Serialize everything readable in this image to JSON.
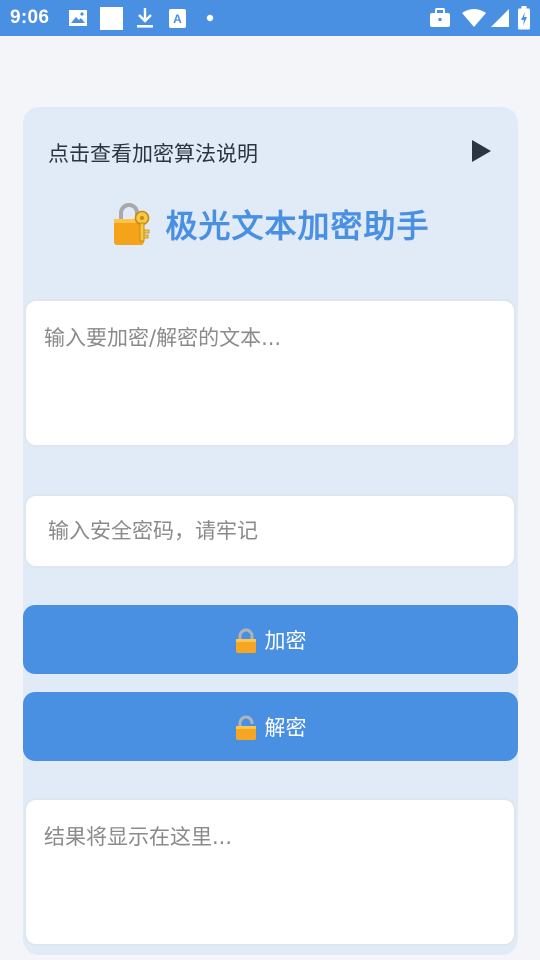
{
  "status_bar": {
    "time": "9:06",
    "icons": [
      "image-icon",
      "square-icon",
      "download-icon",
      "translate-icon",
      "dot-icon",
      "briefcase-icon",
      "wifi-icon",
      "signal-icon",
      "battery-icon"
    ],
    "color": "#4a90e2"
  },
  "header": {
    "toggle_label": "点击查看加密算法说明",
    "toggle_icon": "play-icon",
    "title": "极光文本加密助手",
    "title_icon": "lock-with-key-icon",
    "accent_color": "#4a90e2"
  },
  "form": {
    "source_placeholder": "输入要加密/解密的文本...",
    "source_value": "",
    "password_placeholder": "输入安全密码，请牢记",
    "password_value": "",
    "encrypt_label": "加密",
    "encrypt_icon": "locked-icon",
    "decrypt_label": "解密",
    "decrypt_icon": "unlocked-icon",
    "result_placeholder": "结果将显示在这里...",
    "result_value": ""
  }
}
